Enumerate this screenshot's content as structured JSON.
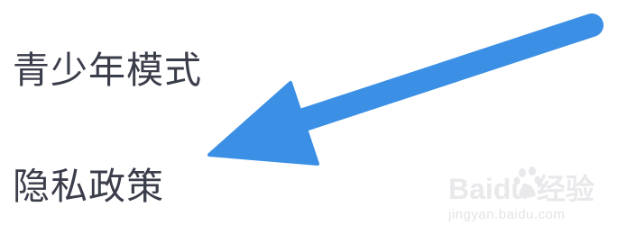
{
  "menu": {
    "items": [
      {
        "label": "青少年模式"
      },
      {
        "label": "隐私政策"
      }
    ]
  },
  "annotation": {
    "arrow_color": "#3b8fe5",
    "arrow_target": "menu.items.1"
  },
  "watermark": {
    "brand_text": "Baidu 经验",
    "url_text": "jingyan.baidu.com",
    "color": "#e9e9ec"
  },
  "colors": {
    "background": "#ffffff",
    "menu_text": "#3a3d4a"
  }
}
